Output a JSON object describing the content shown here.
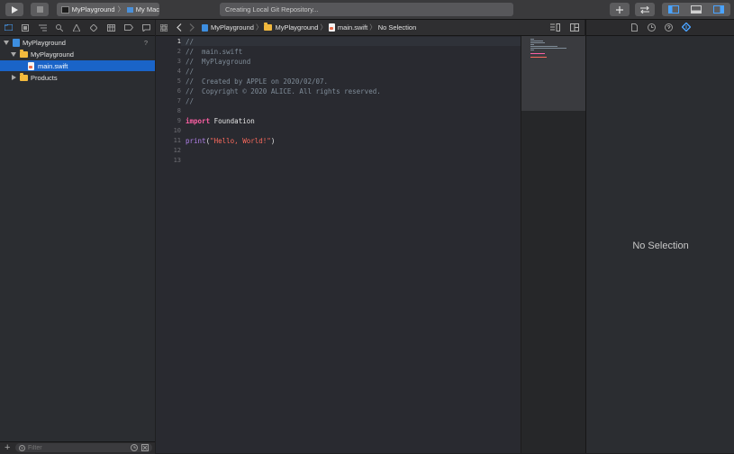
{
  "toolbar": {
    "run_icon": "play-icon",
    "stop_icon": "stop-icon",
    "scheme": "MyPlayground",
    "destination": "My Mac",
    "activity_status": "Creating Local Git Repository...",
    "add_icon": "plus-icon",
    "swap_icon": "swap-arrows-icon"
  },
  "navigator": {
    "tree": [
      {
        "label": "MyPlayground",
        "level": 0,
        "kind": "project",
        "expanded": true,
        "badge": "?"
      },
      {
        "label": "MyPlayground",
        "level": 1,
        "kind": "folder",
        "expanded": true
      },
      {
        "label": "main.swift",
        "level": 2,
        "kind": "swift-file",
        "selected": true
      },
      {
        "label": "Products",
        "level": 1,
        "kind": "folder",
        "expanded": false
      }
    ],
    "filter_placeholder": "Filter"
  },
  "jumpbar": {
    "crumbs": [
      "MyPlayground",
      "MyPlayground",
      "main.swift",
      "No Selection"
    ]
  },
  "editor": {
    "current_line": 1,
    "lines": [
      "//",
      "//  main.swift",
      "//  MyPlayground",
      "//",
      "//  Created by APPLE on 2020/02/07.",
      "//  Copyright © 2020 ALICE. All rights reserved.",
      "//",
      "",
      "import Foundation",
      "",
      "print(\"Hello, World!\")",
      "",
      ""
    ],
    "tokens": {
      "import_kw": "import",
      "import_mod": " Foundation",
      "print_fn": "print",
      "paren_open": "(",
      "string": "\"Hello, World!\"",
      "paren_close": ")"
    }
  },
  "inspector": {
    "empty_message": "No Selection"
  },
  "colors": {
    "selection": "#1a64c8",
    "keyword": "#fc5fa3",
    "string": "#fc6a5d",
    "comment": "#7f8c98",
    "function": "#b281eb",
    "folder": "#f2b93d"
  }
}
